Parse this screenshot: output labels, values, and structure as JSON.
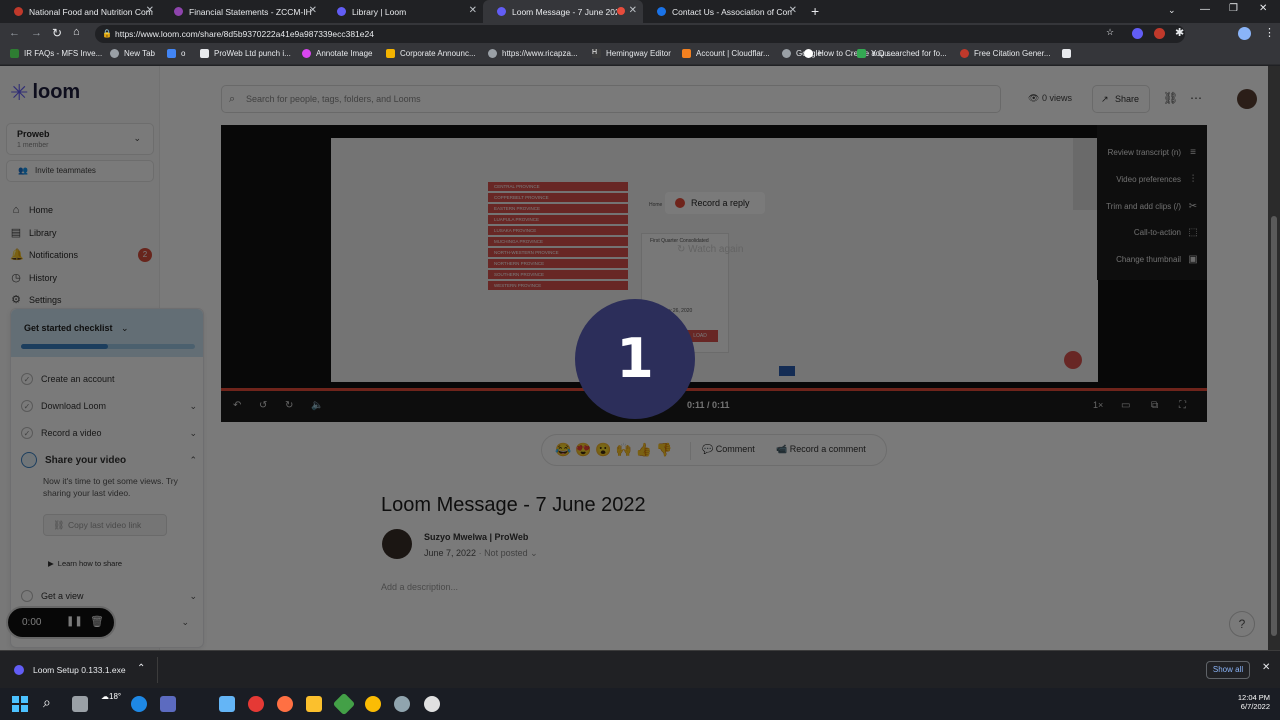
{
  "browser": {
    "tabs": [
      {
        "title": "National Food and Nutrition Com",
        "color": "#c0392b"
      },
      {
        "title": "Financial Statements - ZCCM-IH",
        "color": "#8e44ad"
      },
      {
        "title": "Library | Loom",
        "color": "#625df5"
      },
      {
        "title": "Loom Message - 7 June 2022",
        "color": "#625df5"
      },
      {
        "title": "Contact Us - Association of Cons",
        "color": "#1a73e8"
      }
    ],
    "url": "https://www.loom.com/share/8d5b9370222a41e9a987339ecc381e24",
    "bookmarks": [
      "IR FAQs - MFS Inve...",
      "New Tab",
      "o",
      "ProWeb Ltd punch i...",
      "Annotate Image",
      "Corporate Announc...",
      "https://www.ricapza...",
      "Hemingway Editor",
      "Account | Cloudflar...",
      "Google",
      "How to Create a Qu...",
      "You searched for fo...",
      "Free Citation Gener..."
    ]
  },
  "sidebar": {
    "logo": "loom",
    "workspace": {
      "name": "Proweb",
      "members": "1 member"
    },
    "invite": "Invite teammates",
    "nav": [
      {
        "label": "Home",
        "icon": "home-icon"
      },
      {
        "label": "Library",
        "icon": "library-icon"
      },
      {
        "label": "Notifications",
        "icon": "bell-icon",
        "badge": "2"
      },
      {
        "label": "History",
        "icon": "history-icon"
      },
      {
        "label": "Settings",
        "icon": "gear-icon"
      }
    ],
    "checklist": {
      "title": "Get started checklist",
      "items": [
        "Create an account",
        "Download Loom",
        "Record a video"
      ],
      "share": {
        "title": "Share your video",
        "desc": "Now it's time to get some views. Try sharing your last video.",
        "button": "Copy last video link",
        "link": "Learn how to share"
      },
      "get_view": "Get a view"
    },
    "recorder": {
      "time": "0:00"
    }
  },
  "header": {
    "search_placeholder": "Search for people, tags, folders, and Looms",
    "views": "0 views",
    "share": "Share"
  },
  "player": {
    "record_reply": "Record a reply",
    "watch_again": "Watch again",
    "time": "0:11 / 0:11",
    "speed": "1×",
    "progress": 1.0,
    "side_menu": [
      "Review transcript (n)",
      "Video preferences",
      "Trim and add clips (/)",
      "Call-to-action",
      "Change thumbnail"
    ],
    "provinces": [
      "CENTRAL PROVINCE",
      "COPPERBELT PROVINCE",
      "EASTERN PROVINCE",
      "LUAPULA PROVINCE",
      "LUSAKA PROVINCE",
      "MUCHINGA PROVINCE",
      "NORTH-WESTERN PROVINCE",
      "NORTHERN PROVINCE",
      "SOUTHERN PROVINCE",
      "WESTERN PROVINCE"
    ],
    "frame_texts": {
      "home": "Home",
      "report": "First Quarter Consolidated",
      "date": "May 26, 2020",
      "load": "LOAD"
    }
  },
  "reactions": {
    "emojis": [
      "😂",
      "😍",
      "😮",
      "🙌",
      "👍",
      "👎"
    ],
    "comment": "Comment",
    "record_comment": "Record a comment"
  },
  "video": {
    "title": "Loom Message - 7 June 2022",
    "author": "Suzyo Mwelwa | ProWeb",
    "date": "June 7, 2022",
    "posted": "Not posted",
    "description_placeholder": "Add a description..."
  },
  "overlay_number": "1",
  "download": {
    "file": "Loom Setup 0.133.1.exe",
    "show_all": "Show all"
  },
  "taskbar": {
    "weather": "18°",
    "time": "12:04 PM",
    "date": "6/7/2022"
  }
}
